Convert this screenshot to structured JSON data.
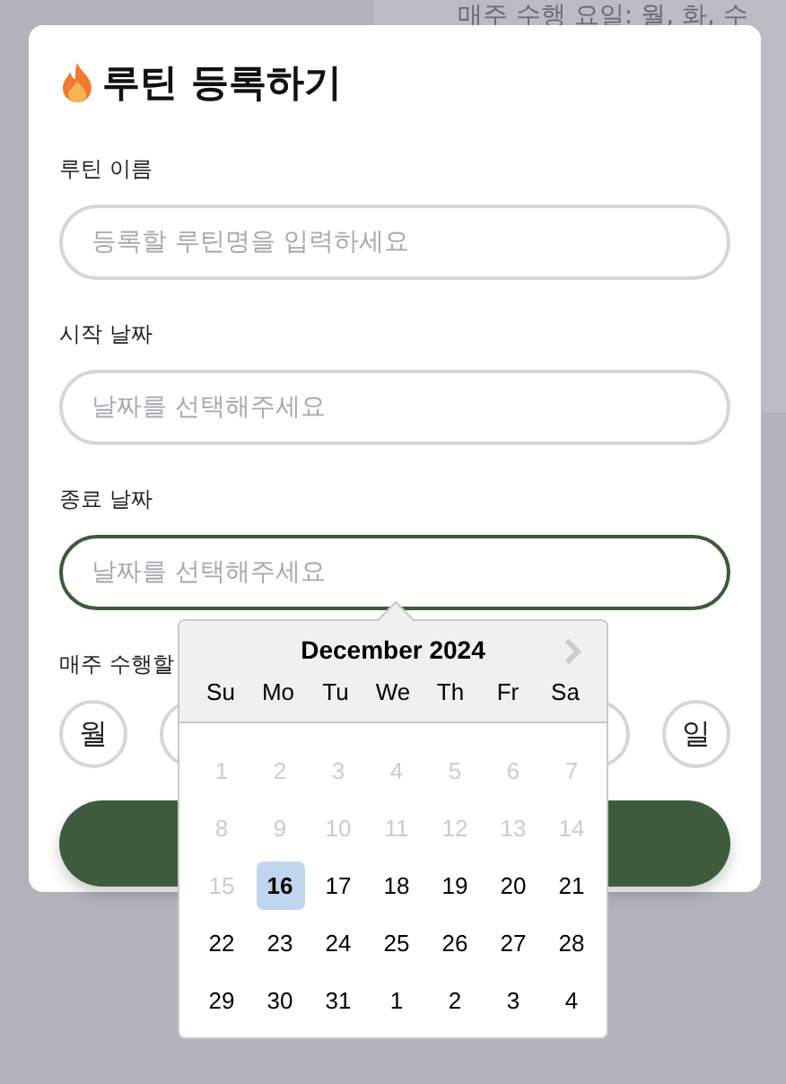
{
  "background": {
    "text": "매주 수행 요일: 월, 화, 수"
  },
  "modal": {
    "title": "루틴 등록하기",
    "fields": [
      {
        "label": "루틴 이름",
        "placeholder": "등록할 루틴명을 입력하세요",
        "focused": false
      },
      {
        "label": "시작 날짜",
        "placeholder": "날짜를 선택해주세요",
        "focused": false
      },
      {
        "label": "종료 날짜",
        "placeholder": "날짜를 선택해주세요",
        "focused": true
      }
    ],
    "weekdays_label": "매주 수행할",
    "weekdays": [
      {
        "label": "월",
        "selected": false
      },
      {
        "label": "일",
        "selected": false
      }
    ]
  },
  "datepicker": {
    "month": "December 2024",
    "next_disabled": true,
    "weekday_headers": [
      "Su",
      "Mo",
      "Tu",
      "We",
      "Th",
      "Fr",
      "Sa"
    ],
    "days": [
      {
        "text": "1",
        "disabled": true,
        "selected": false
      },
      {
        "text": "2",
        "disabled": true,
        "selected": false
      },
      {
        "text": "3",
        "disabled": true,
        "selected": false
      },
      {
        "text": "4",
        "disabled": true,
        "selected": false
      },
      {
        "text": "5",
        "disabled": true,
        "selected": false
      },
      {
        "text": "6",
        "disabled": true,
        "selected": false
      },
      {
        "text": "7",
        "disabled": true,
        "selected": false
      },
      {
        "text": "8",
        "disabled": true,
        "selected": false
      },
      {
        "text": "9",
        "disabled": true,
        "selected": false
      },
      {
        "text": "10",
        "disabled": true,
        "selected": false
      },
      {
        "text": "11",
        "disabled": true,
        "selected": false
      },
      {
        "text": "12",
        "disabled": true,
        "selected": false
      },
      {
        "text": "13",
        "disabled": true,
        "selected": false
      },
      {
        "text": "14",
        "disabled": true,
        "selected": false
      },
      {
        "text": "15",
        "disabled": true,
        "selected": false
      },
      {
        "text": "16",
        "disabled": false,
        "selected": true
      },
      {
        "text": "17",
        "disabled": false,
        "selected": false
      },
      {
        "text": "18",
        "disabled": false,
        "selected": false
      },
      {
        "text": "19",
        "disabled": false,
        "selected": false
      },
      {
        "text": "20",
        "disabled": false,
        "selected": false
      },
      {
        "text": "21",
        "disabled": false,
        "selected": false
      },
      {
        "text": "22",
        "disabled": false,
        "selected": false
      },
      {
        "text": "23",
        "disabled": false,
        "selected": false
      },
      {
        "text": "24",
        "disabled": false,
        "selected": false
      },
      {
        "text": "25",
        "disabled": false,
        "selected": false
      },
      {
        "text": "26",
        "disabled": false,
        "selected": false
      },
      {
        "text": "27",
        "disabled": false,
        "selected": false
      },
      {
        "text": "28",
        "disabled": false,
        "selected": false
      },
      {
        "text": "29",
        "disabled": false,
        "selected": false
      },
      {
        "text": "30",
        "disabled": false,
        "selected": false
      },
      {
        "text": "31",
        "disabled": false,
        "selected": false
      },
      {
        "text": "1",
        "disabled": false,
        "selected": false
      },
      {
        "text": "2",
        "disabled": false,
        "selected": false
      },
      {
        "text": "3",
        "disabled": false,
        "selected": false
      },
      {
        "text": "4",
        "disabled": false,
        "selected": false
      }
    ]
  }
}
